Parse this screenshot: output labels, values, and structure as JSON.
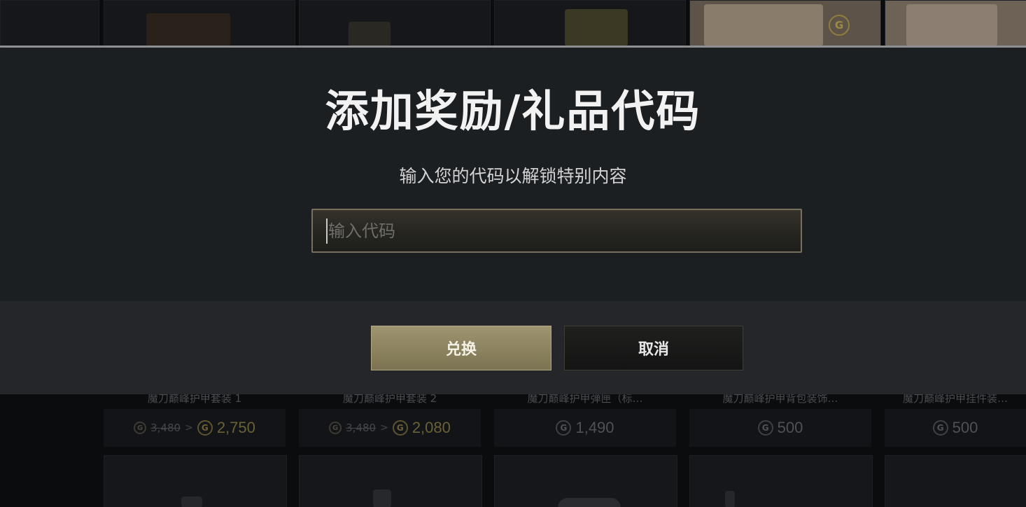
{
  "dialog": {
    "title": "添加奖励/礼品代码",
    "subtitle": "输入您的代码以解锁特别内容",
    "input_placeholder": "输入代码",
    "redeem_label": "兑换",
    "cancel_label": "取消"
  },
  "store_items": [
    {
      "name": "魔刀巅峰护甲套装 1",
      "coin_symbol": "G",
      "old_price": "3,480",
      "arrow": ">",
      "price": "2,750"
    },
    {
      "name": "魔刀巅峰护甲套装 2",
      "coin_symbol": "G",
      "old_price": "3,480",
      "arrow": ">",
      "price": "2,080"
    },
    {
      "name": "魔刀巅峰护甲弹匣（标…",
      "coin_symbol": "G",
      "price": "1,490"
    },
    {
      "name": "魔刀巅峰护甲背包装饰…",
      "coin_symbol": "G",
      "price": "500"
    },
    {
      "name": "魔刀巅峰护甲挂件装…",
      "coin_symbol": "G",
      "price": "500"
    }
  ],
  "colors": {
    "dialog_bg": "#1c1f22",
    "footer_bg": "#24262a",
    "accent_gold": "#9e9470",
    "coin_gold": "#6b6137"
  }
}
